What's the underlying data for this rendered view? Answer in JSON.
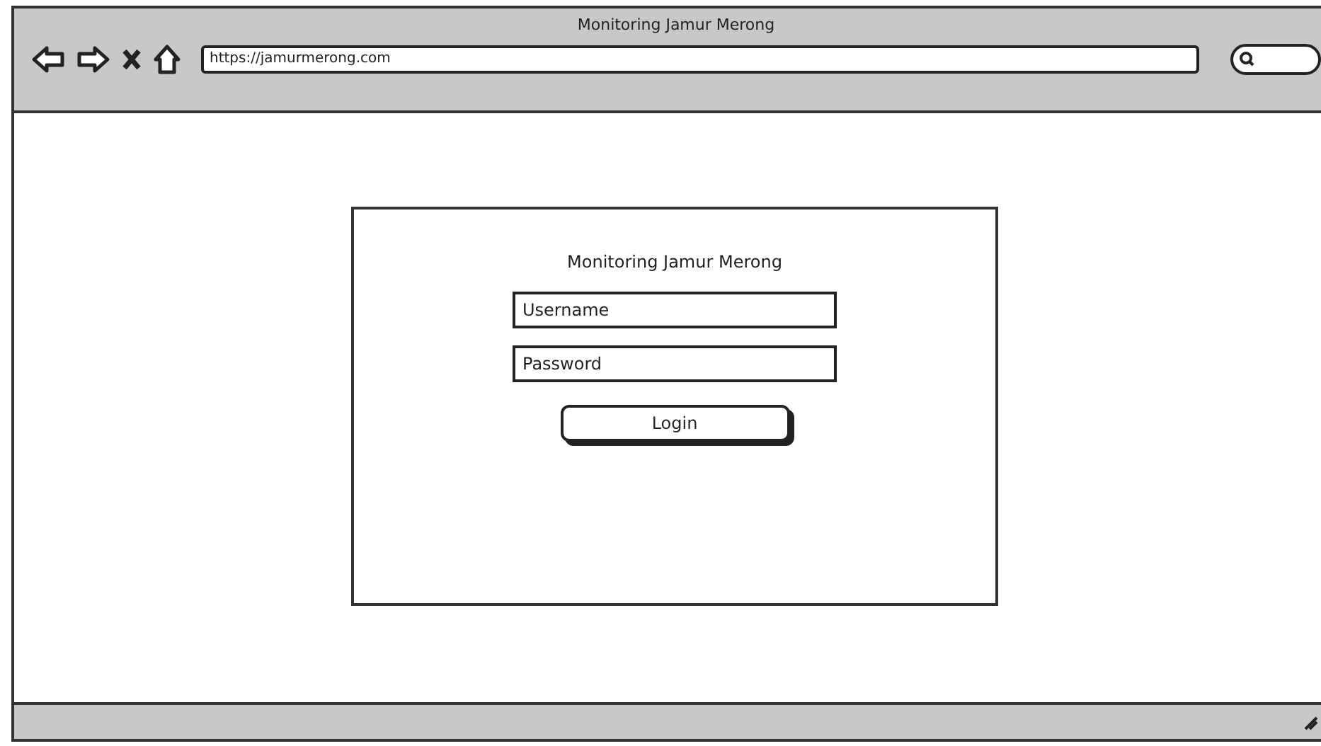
{
  "window": {
    "title": "Monitoring Jamur Merong"
  },
  "toolbar": {
    "url": "https://jamurmerong.com"
  },
  "login": {
    "title": "Monitoring Jamur Merong",
    "fields": [
      {
        "placeholder": "Username"
      },
      {
        "placeholder": "Password"
      }
    ],
    "button": "Login"
  }
}
